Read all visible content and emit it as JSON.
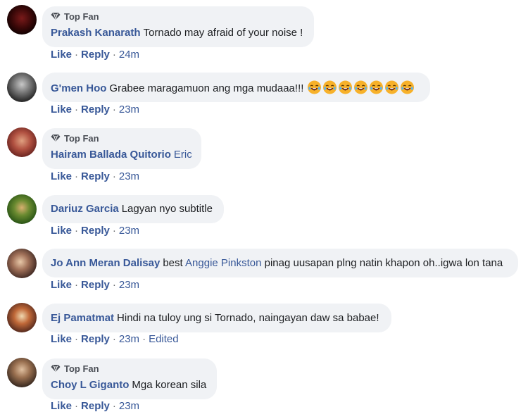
{
  "colors": {
    "author": "#385898",
    "bubble": "#f0f2f5",
    "badge": "#4b4f56",
    "text": "#1c1e21",
    "emoji_face": "#f7b12a"
  },
  "badge_icon": "diamond-icon",
  "comments": [
    {
      "top_fan": "Top Fan",
      "author": "Prakash Kanarath",
      "text": "Tornado may afraid of your noise !",
      "like": "Like",
      "reply": "Reply",
      "time": "24m"
    },
    {
      "author": "G'men Hoo",
      "text": "Grabee maragamuon ang mga mudaaa!!!",
      "emoji_icon": "laughing-tears-emoji-icon",
      "emoji_count": 7,
      "like": "Like",
      "reply": "Reply",
      "time": "23m"
    },
    {
      "top_fan": "Top Fan",
      "author": "Hairam Ballada Quitorio",
      "text": "Eric",
      "like": "Like",
      "reply": "Reply",
      "time": "23m"
    },
    {
      "author": "Dariuz Garcia",
      "text": "Lagyan nyo subtitle",
      "like": "Like",
      "reply": "Reply",
      "time": "23m"
    },
    {
      "author": "Jo Ann Meran Dalisay",
      "text_before": "best",
      "mention": "Anggie Pinkston",
      "text": "pinag uusapan plng natin khapon oh..igwa lon tana",
      "like": "Like",
      "reply": "Reply",
      "time": "23m"
    },
    {
      "author": "Ej Pamatmat",
      "text": "Hindi na tuloy ung si Tornado, naingayan daw sa babae!",
      "like": "Like",
      "reply": "Reply",
      "time": "23m",
      "edited": "Edited"
    },
    {
      "top_fan": "Top Fan",
      "author": "Choy L Giganto",
      "text": "Mga korean sila",
      "like": "Like",
      "reply": "Reply",
      "time": "23m"
    }
  ]
}
